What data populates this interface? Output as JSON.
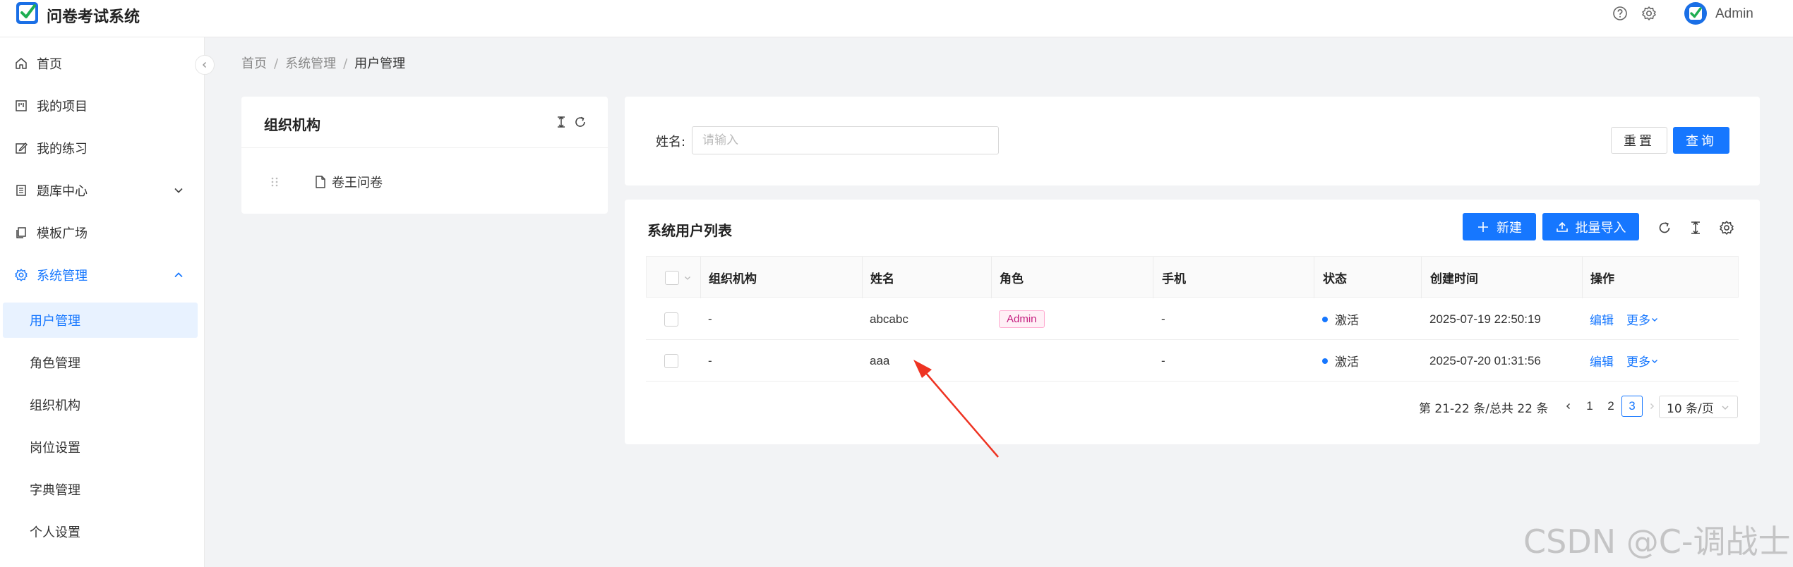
{
  "app": {
    "title": "问卷考试系统",
    "user_name": "Admin"
  },
  "sidebar": {
    "items": [
      {
        "label": "首页",
        "icon": "home-icon"
      },
      {
        "label": "我的项目",
        "icon": "project-icon"
      },
      {
        "label": "我的练习",
        "icon": "edit-icon"
      },
      {
        "label": "题库中心",
        "icon": "list-icon"
      },
      {
        "label": "模板广场",
        "icon": "copy-icon"
      },
      {
        "label": "系统管理",
        "icon": "gear-icon"
      }
    ],
    "sub_items": [
      {
        "label": "用户管理"
      },
      {
        "label": "角色管理"
      },
      {
        "label": "组织机构"
      },
      {
        "label": "岗位设置"
      },
      {
        "label": "字典管理"
      },
      {
        "label": "个人设置"
      }
    ]
  },
  "breadcrumb": {
    "items": [
      "首页",
      "系统管理",
      "用户管理"
    ]
  },
  "org_panel": {
    "title": "组织机构",
    "tree": [
      {
        "label": "卷王问卷"
      }
    ]
  },
  "search": {
    "name_label": "姓名:",
    "name_placeholder": "请输入",
    "reset_label": "重置",
    "query_label": "查询"
  },
  "user_list": {
    "title": "系统用户列表",
    "new_label": "新建",
    "import_label": "批量导入",
    "columns": [
      "组织机构",
      "姓名",
      "角色",
      "手机",
      "状态",
      "创建时间",
      "操作"
    ],
    "rows": [
      {
        "org": "-",
        "name": "abcabc",
        "role": "Admin",
        "phone": "-",
        "status": "激活",
        "created": "2025-07-19 22:50:19",
        "edit": "编辑",
        "more": "更多"
      },
      {
        "org": "-",
        "name": "aaa",
        "role": "",
        "phone": "-",
        "status": "激活",
        "created": "2025-07-20 01:31:56",
        "edit": "编辑",
        "more": "更多"
      }
    ]
  },
  "pagination": {
    "total_text": "第 21-22 条/总共 22 条",
    "pages": [
      "1",
      "2",
      "3"
    ],
    "current_page": "3",
    "page_size": "10 条/页"
  },
  "colors": {
    "primary": "#1677ff",
    "admin_tag": "#c41d7f",
    "annotation_arrow": "#ee3322"
  },
  "watermark": "CSDN @C-调战士"
}
